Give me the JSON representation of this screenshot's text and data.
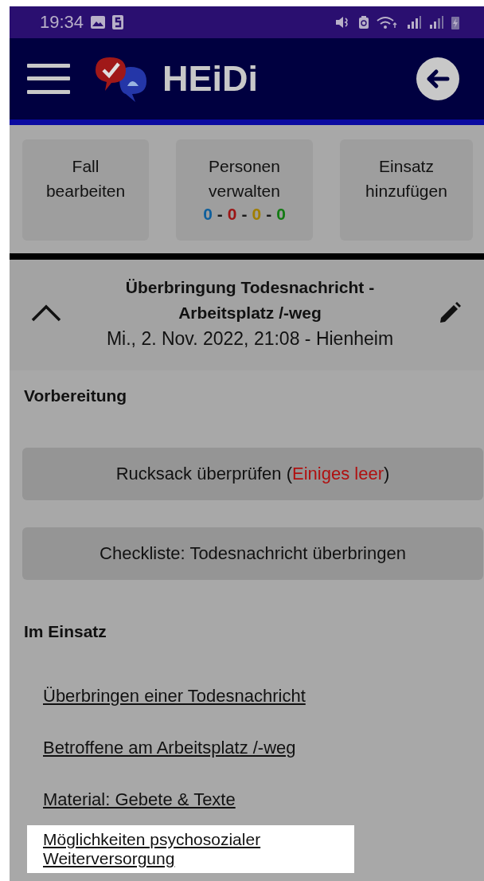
{
  "status_bar": {
    "time": "19:34"
  },
  "app_bar": {
    "title": "HEiDi"
  },
  "actions": [
    {
      "label": "Fall bearbeiten"
    },
    {
      "label": "Personen verwalten",
      "counts": [
        {
          "text": "0",
          "color": "#0f5f9c"
        },
        {
          "text": "-",
          "color": "#1a1a1a"
        },
        {
          "text": "0",
          "color": "#9c1414"
        },
        {
          "text": "-",
          "color": "#1a1a1a"
        },
        {
          "text": "0",
          "color": "#a07e00"
        },
        {
          "text": "-",
          "color": "#1a1a1a"
        },
        {
          "text": "0",
          "color": "#137a13"
        }
      ]
    },
    {
      "label": "Einsatz hinzufügen"
    }
  ],
  "case": {
    "expanded": true,
    "title": "Überbringung Todesnachricht - Arbeitsplatz /-weg",
    "subtitle": "Mi., 2. Nov. 2022, 21:08 - Hienheim"
  },
  "sections": [
    {
      "heading": "Vorbereitung",
      "items": [
        {
          "kind": "button",
          "parts": [
            {
              "text": "Rucksack überprüfen (",
              "alert": false
            },
            {
              "text": "Einiges leer",
              "alert": true
            },
            {
              "text": ")",
              "alert": false
            }
          ]
        },
        {
          "kind": "button",
          "parts": [
            {
              "text": "Checkliste: Todesnachricht überbringen",
              "alert": false
            }
          ]
        }
      ]
    },
    {
      "heading": "Im Einsatz",
      "items": [
        {
          "kind": "link",
          "label": "Überbringen einer Todesnachricht",
          "highlighted": false
        },
        {
          "kind": "link",
          "label": "Betroffene am Arbeitsplatz /-weg",
          "highlighted": false
        },
        {
          "kind": "link",
          "label": "Material: Gebete & Texte",
          "highlighted": false
        },
        {
          "kind": "link",
          "label": "Möglichkeiten psychosozialer Weiterversorgung",
          "highlighted": true
        }
      ]
    }
  ]
}
